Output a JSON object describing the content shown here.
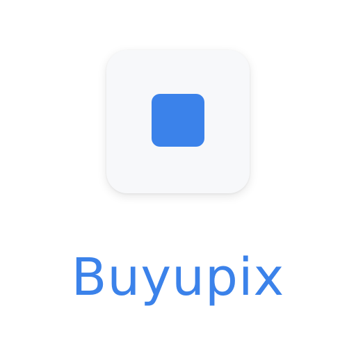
{
  "brand": {
    "name": "Buyupix",
    "accent_color": "#3b82ea",
    "tile_color": "#f7f8fa"
  },
  "icon": {
    "semantic_name": "app-logo-square-icon"
  }
}
